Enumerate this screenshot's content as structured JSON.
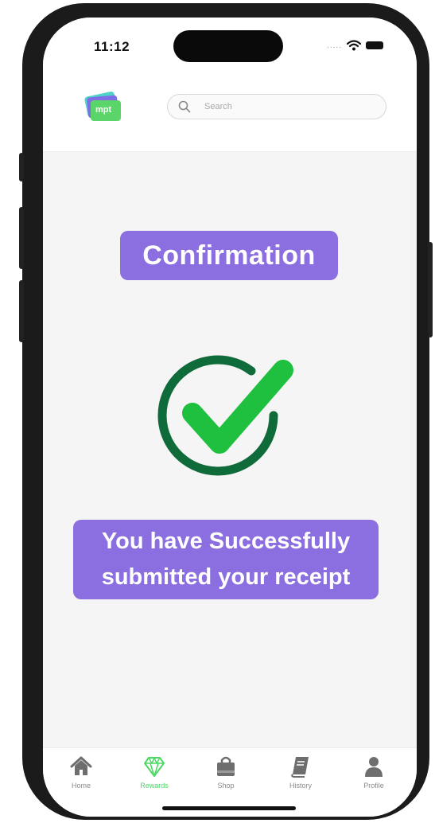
{
  "status": {
    "time": "11:12",
    "dots": "....."
  },
  "logo": {
    "text": "mpt"
  },
  "search": {
    "placeholder": "Search"
  },
  "confirmation": {
    "title": "Confirmation",
    "message": "You have  Successfully\nsubmitted your receipt"
  },
  "tabbar": {
    "items": [
      {
        "label": "Home",
        "icon": "home-icon"
      },
      {
        "label": "Rewards",
        "icon": "diamond-icon"
      },
      {
        "label": "Shop",
        "icon": "shopping-bag-icon"
      },
      {
        "label": "History",
        "icon": "book-icon"
      },
      {
        "label": "Profile",
        "icon": "user-icon"
      }
    ],
    "active": "Rewards"
  },
  "colors": {
    "accent": "#8b6fe0",
    "success_dark": "#0f6b3a",
    "success": "#1fbf3f",
    "active_tab": "#4cd964"
  }
}
